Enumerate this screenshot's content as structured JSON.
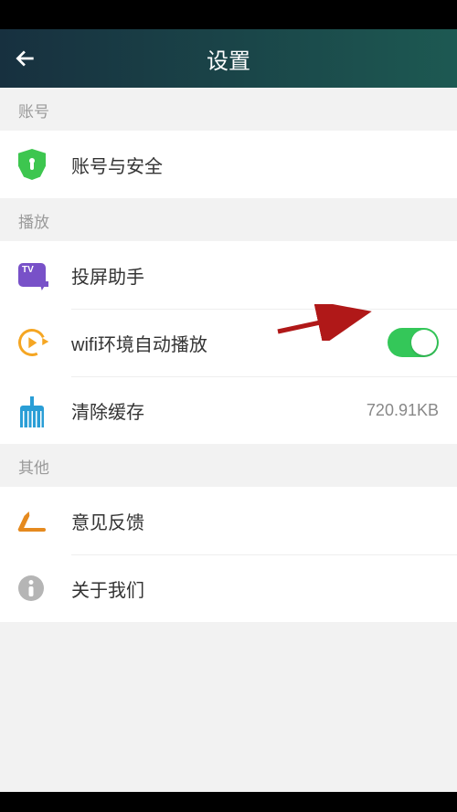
{
  "header": {
    "title": "设置"
  },
  "sections": {
    "account": {
      "header": "账号",
      "security_label": "账号与安全"
    },
    "playback": {
      "header": "播放",
      "cast_label": "投屏助手",
      "wifi_autoplay_label": "wifi环境自动播放",
      "wifi_autoplay_on": true,
      "clear_cache_label": "清除缓存",
      "clear_cache_value": "720.91KB"
    },
    "other": {
      "header": "其他",
      "feedback_label": "意见反馈",
      "about_label": "关于我们"
    }
  }
}
